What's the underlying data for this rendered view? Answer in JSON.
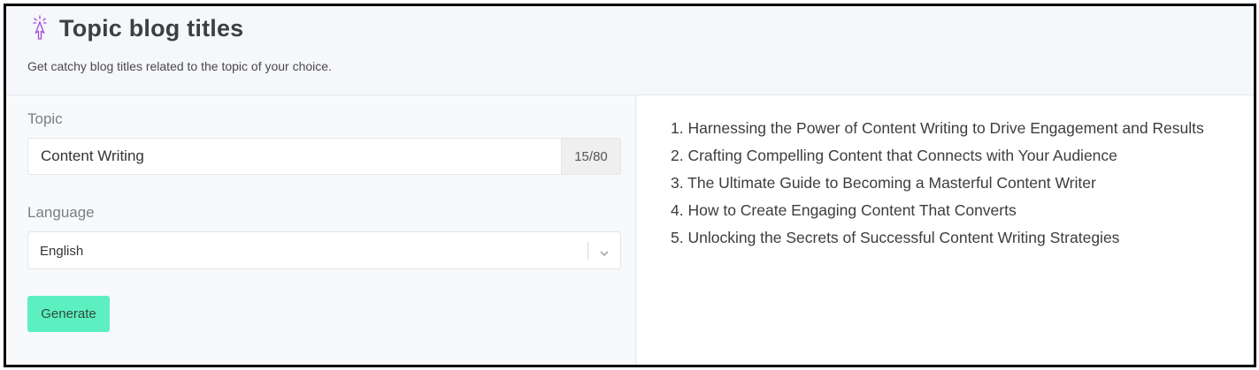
{
  "header": {
    "icon": "magic-wand-icon",
    "title": "Topic blog titles",
    "subtitle": "Get catchy blog titles related to the topic of your choice."
  },
  "form": {
    "topic_label": "Topic",
    "topic_value": "Content Writing",
    "topic_count": "15/80",
    "language_label": "Language",
    "language_value": "English",
    "generate_label": "Generate"
  },
  "results": [
    "1. Harnessing the Power of Content Writing to Drive Engagement and Results",
    "2. Crafting Compelling Content that Connects with Your Audience",
    "3. The Ultimate Guide to Becoming a Masterful Content Writer",
    "4. How to Create Engaging Content That Converts",
    "5. Unlocking the Secrets of Successful Content Writing Strategies"
  ],
  "colors": {
    "accent": "#5cf0c0",
    "icon": "#a24bd6",
    "border": "#000000"
  }
}
